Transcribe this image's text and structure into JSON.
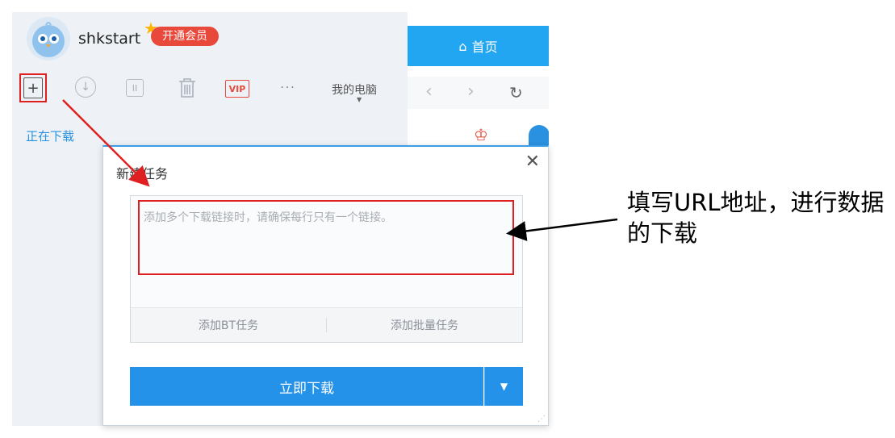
{
  "user": {
    "name": "shkstart",
    "vip_label": "开通会员"
  },
  "toolbar": {
    "device_label": "我的电脑",
    "more_label": "···"
  },
  "sidebar": {
    "downloading_label": "正在下载"
  },
  "browser": {
    "home_tab_label": "首页"
  },
  "dialog": {
    "title": "新建任务",
    "url_placeholder": "添加多个下载链接时，请确保每行只有一个链接。",
    "add_bt_label": "添加BT任务",
    "add_batch_label": "添加批量任务",
    "download_now_label": "立即下载"
  },
  "annotation": {
    "text": "填写URL地址，进行数据的下载"
  },
  "colors": {
    "accent_blue": "#2592ea",
    "highlight_red": "#e02020",
    "vip_red": "#e8493a"
  }
}
